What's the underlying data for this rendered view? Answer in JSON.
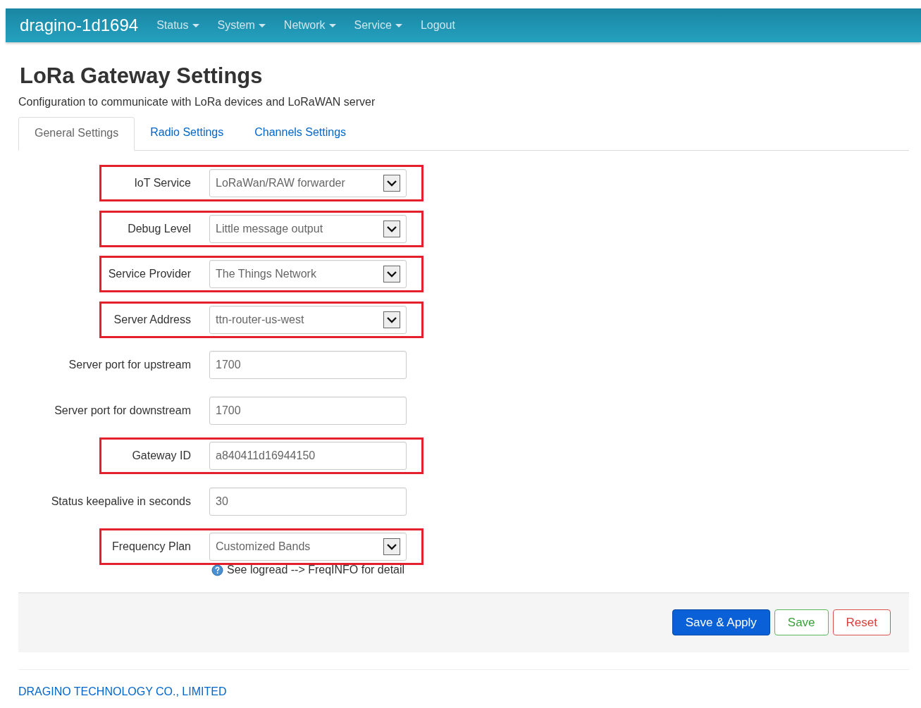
{
  "navbar": {
    "brand": "dragino-1d1694",
    "menu": [
      {
        "label": "Status",
        "dropdown": true
      },
      {
        "label": "System",
        "dropdown": true
      },
      {
        "label": "Network",
        "dropdown": true
      },
      {
        "label": "Service",
        "dropdown": true
      },
      {
        "label": "Logout",
        "dropdown": false
      }
    ]
  },
  "page": {
    "title": "LoRa Gateway Settings",
    "description": "Configuration to communicate with LoRa devices and LoRaWAN server"
  },
  "tabs": [
    {
      "label": "General Settings",
      "selected": true
    },
    {
      "label": "Radio Settings",
      "selected": false
    },
    {
      "label": "Channels Settings",
      "selected": false
    }
  ],
  "fields": [
    {
      "label": "IoT Service",
      "kind": "select",
      "value": "LoRaWan/RAW forwarder",
      "highlighted": true
    },
    {
      "label": "Debug Level",
      "kind": "select",
      "value": "Little message output",
      "highlighted": true
    },
    {
      "label": "Service Provider",
      "kind": "select",
      "value": "The Things Network",
      "highlighted": true
    },
    {
      "label": "Server Address",
      "kind": "select",
      "value": "ttn-router-us-west",
      "highlighted": true
    },
    {
      "label": "Server port for upstream",
      "kind": "text",
      "value": "1700",
      "highlighted": false
    },
    {
      "label": "Server port for downstream",
      "kind": "text",
      "value": "1700",
      "highlighted": false
    },
    {
      "label": "Gateway ID",
      "kind": "text",
      "value": "a840411d16944150",
      "highlighted": true
    },
    {
      "label": "Status keepalive in seconds",
      "kind": "text",
      "value": "30",
      "highlighted": false
    },
    {
      "label": "Frequency Plan",
      "kind": "select",
      "value": "Customized Bands",
      "highlighted": true,
      "hint": "See logread --> FreqINFO for detail"
    }
  ],
  "actions": [
    {
      "label": "Save & Apply",
      "kind": "primary"
    },
    {
      "label": "Save",
      "kind": "success"
    },
    {
      "label": "Reset",
      "kind": "danger"
    }
  ],
  "footer": "DRAGINO TECHNOLOGY CO., LIMITED"
}
